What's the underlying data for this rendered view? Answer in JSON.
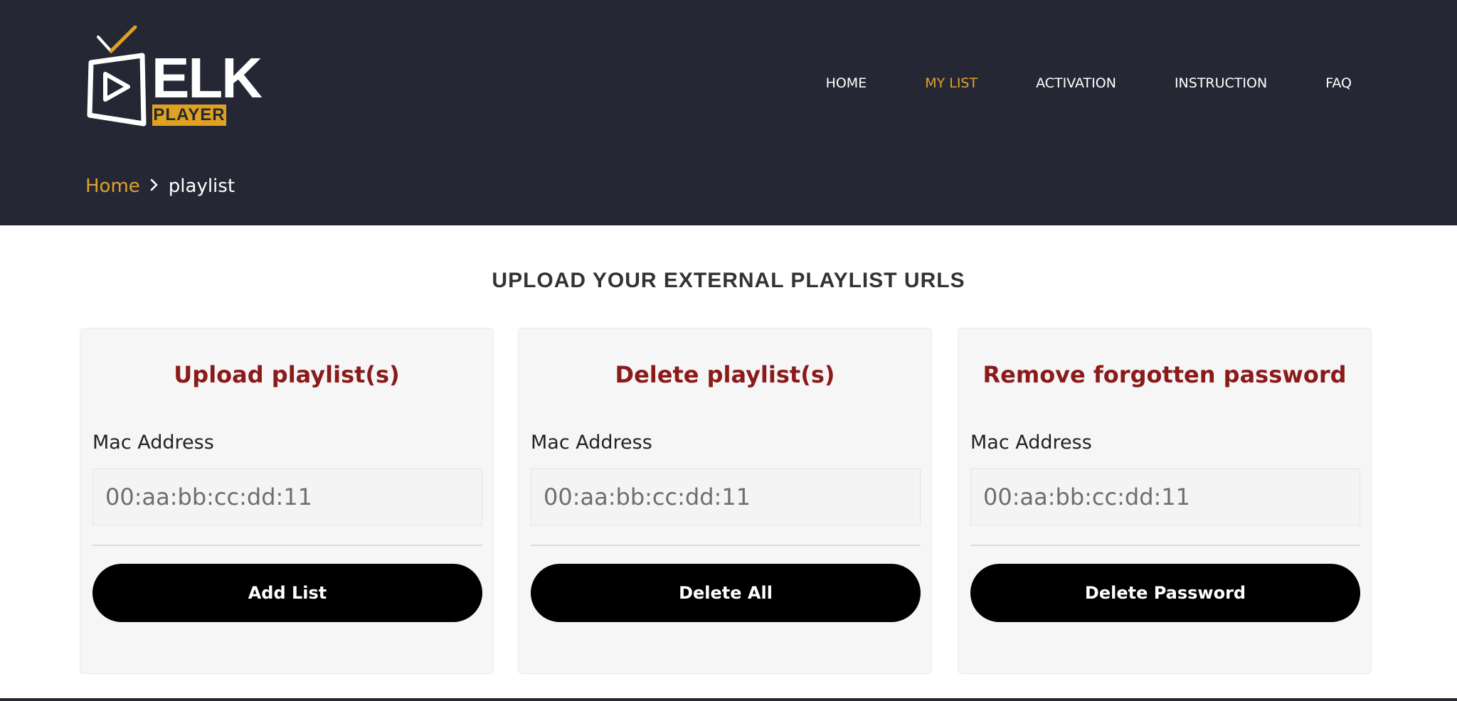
{
  "brand": {
    "logo_text": "ELK",
    "logo_sub": "PLAYER",
    "accent_color": "#e0a12a",
    "header_bg": "#252834"
  },
  "nav": {
    "items": [
      {
        "label": "HOME",
        "active": false
      },
      {
        "label": "MY LIST",
        "active": true
      },
      {
        "label": "ACTIVATION",
        "active": false
      },
      {
        "label": "INSTRUCTION",
        "active": false
      },
      {
        "label": "FAQ",
        "active": false
      }
    ]
  },
  "breadcrumb": {
    "home": "Home",
    "separator_icon": "chevron-right-icon",
    "current": "playlist"
  },
  "main": {
    "heading": "UPLOAD YOUR EXTERNAL PLAYLIST URLS",
    "cards": [
      {
        "title": "Upload playlist(s)",
        "field_label": "Mac Address",
        "placeholder": "00:aa:bb:cc:dd:11",
        "button_label": "Add List"
      },
      {
        "title": "Delete playlist(s)",
        "field_label": "Mac Address",
        "placeholder": "00:aa:bb:cc:dd:11",
        "button_label": "Delete All"
      },
      {
        "title": "Remove forgotten password",
        "field_label": "Mac Address",
        "placeholder": "00:aa:bb:cc:dd:11",
        "button_label": "Delete Password"
      }
    ],
    "title_color": "#8b1a1a"
  }
}
